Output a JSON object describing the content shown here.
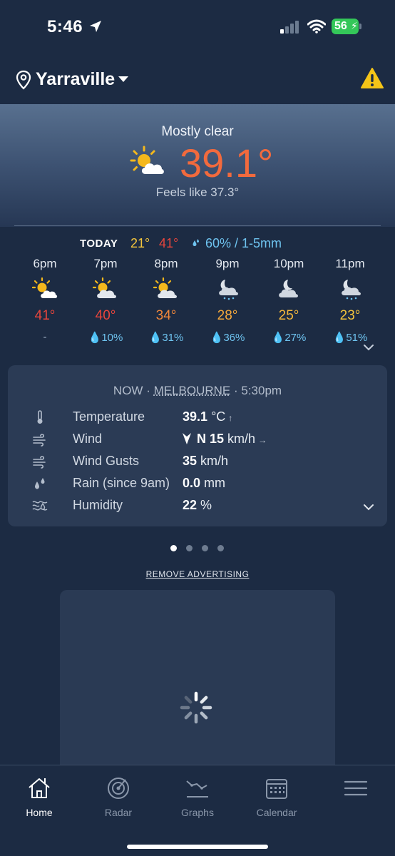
{
  "status_bar": {
    "time": "5:46",
    "battery": "56"
  },
  "header": {
    "location": "Yarraville"
  },
  "current": {
    "condition": "Mostly clear",
    "temperature": "39.1°",
    "feels_like": "Feels like 37.3°"
  },
  "today": {
    "label": "TODAY",
    "min": "21°",
    "max": "41°",
    "rain": "60% / 1-5mm"
  },
  "hourly": [
    {
      "time": "6pm",
      "icon": "partly-cloudy-sun-icon",
      "temp": "41°",
      "temp_color": "#e8453c",
      "rain": "-"
    },
    {
      "time": "7pm",
      "icon": "partly-cloudy-sun-icon",
      "temp": "40°",
      "temp_color": "#e8453c",
      "rain": "10%"
    },
    {
      "time": "8pm",
      "icon": "partly-cloudy-sun-icon",
      "temp": "34°",
      "temp_color": "#f2883a",
      "rain": "31%"
    },
    {
      "time": "9pm",
      "icon": "moon-cloud-rain-icon",
      "temp": "28°",
      "temp_color": "#f4a83c",
      "rain": "36%"
    },
    {
      "time": "10pm",
      "icon": "moon-cloud-icon",
      "temp": "25°",
      "temp_color": "#f4b83c",
      "rain": "27%"
    },
    {
      "time": "11pm",
      "icon": "moon-cloud-rain-icon",
      "temp": "23°",
      "temp_color": "#f4c53c",
      "rain": "51%"
    }
  ],
  "observations": {
    "heading_prefix": "NOW · ",
    "station": "MELBOURNE",
    "heading_suffix": " · 5:30pm",
    "rows": [
      {
        "icon": "thermometer-icon",
        "label": "Temperature",
        "value": "39.1",
        "unit": "°C",
        "extra": "↑"
      },
      {
        "icon": "wind-icon",
        "label": "Wind",
        "value": "N 15",
        "unit": "km/h",
        "extra": "→"
      },
      {
        "icon": "wind-gusts-icon",
        "label": "Wind Gusts",
        "value": "35",
        "unit": "km/h",
        "extra": ""
      },
      {
        "icon": "rain-drops-icon",
        "label": "Rain (since 9am)",
        "value": "0.0",
        "unit": "mm",
        "extra": ""
      },
      {
        "icon": "humidity-icon",
        "label": "Humidity",
        "value": "22",
        "unit": "%",
        "extra": ""
      }
    ]
  },
  "pager": {
    "count": 4,
    "active": 0
  },
  "remove_ads": "REMOVE ADVERTISING",
  "tabs": [
    {
      "label": "Home",
      "active": true
    },
    {
      "label": "Radar",
      "active": false
    },
    {
      "label": "Graphs",
      "active": false
    },
    {
      "label": "Calendar",
      "active": false
    },
    {
      "label": "",
      "active": false
    }
  ],
  "colors": {
    "background": "#1c2b43",
    "card": "#2b3b55",
    "hot": "#f26a3d",
    "rain": "#6ec3ef",
    "warning": "#f5c518"
  }
}
